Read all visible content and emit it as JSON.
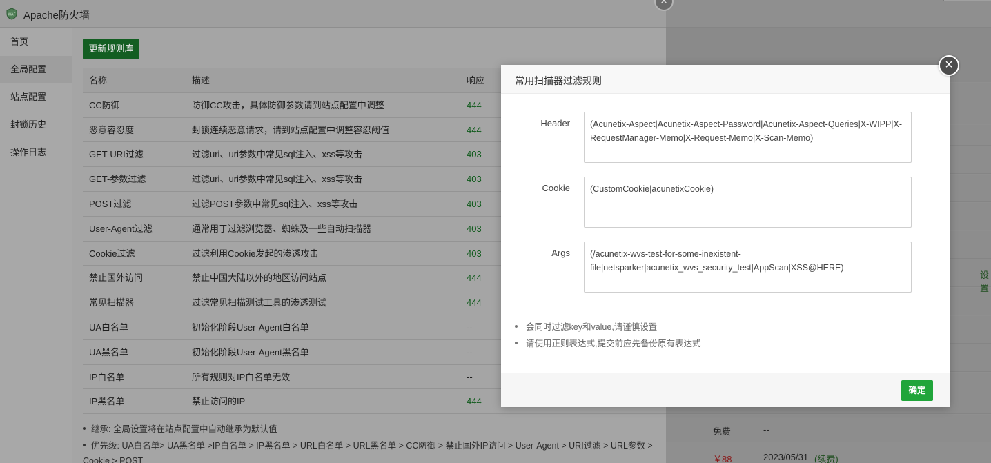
{
  "window": {
    "title": "Apache防火墙"
  },
  "sidebar": {
    "items": [
      {
        "label": "首页"
      },
      {
        "label": "全局配置"
      },
      {
        "label": "站点配置"
      },
      {
        "label": "封锁历史"
      },
      {
        "label": "操作日志"
      }
    ]
  },
  "content": {
    "update_button": "更新规则库",
    "table": {
      "headers": {
        "name": "名称",
        "desc": "描述",
        "resp": "响应"
      },
      "rows": [
        {
          "name": "CC防御",
          "desc": "防御CC攻击，具体防御参数请到站点配置中调整",
          "resp": "444"
        },
        {
          "name": "恶意容忍度",
          "desc": "封锁连续恶意请求，请到站点配置中调整容忍阈值",
          "resp": "444"
        },
        {
          "name": "GET-URI过滤",
          "desc": "过滤uri、uri参数中常见sql注入、xss等攻击",
          "resp": "403"
        },
        {
          "name": "GET-参数过滤",
          "desc": "过滤uri、uri参数中常见sql注入、xss等攻击",
          "resp": "403"
        },
        {
          "name": "POST过滤",
          "desc": "过滤POST参数中常见sql注入、xss等攻击",
          "resp": "403"
        },
        {
          "name": "User-Agent过滤",
          "desc": "通常用于过滤浏览器、蜘蛛及一些自动扫描器",
          "resp": "403"
        },
        {
          "name": "Cookie过滤",
          "desc": "过滤利用Cookie发起的渗透攻击",
          "resp": "403"
        },
        {
          "name": "禁止国外访问",
          "desc": "禁止中国大陆以外的地区访问站点",
          "resp": "444"
        },
        {
          "name": "常见扫描器",
          "desc": "过滤常见扫描测试工具的渗透测试",
          "resp": "444"
        },
        {
          "name": "UA白名单",
          "desc": "初始化阶段User-Agent白名单",
          "resp": "--"
        },
        {
          "name": "UA黑名单",
          "desc": "初始化阶段User-Agent黑名单",
          "resp": "--"
        },
        {
          "name": "IP白名单",
          "desc": "所有规则对IP白名单无效",
          "resp": "--"
        },
        {
          "name": "IP黑名单",
          "desc": "禁止访问的IP",
          "resp": "444"
        }
      ]
    },
    "notes": [
      "继承: 全局设置将在站点配置中自动继承为默认值",
      "优先级: UA白名单> UA黑名单 >IP白名单 > IP黑名单 > URL白名单 > URL黑名单 > CC防御 > 禁止国外IP访问 > User-Agent > URI过滤 > URL参数 >",
      "Cookie > POST"
    ]
  },
  "background_page": {
    "row_label_1": "设置",
    "row_type": "免费",
    "row_value": "--",
    "price": "￥88",
    "expiry_date": "2023/05/31",
    "renew": "(续费)"
  },
  "modal": {
    "title": "常用扫描器过滤规则",
    "fields": {
      "header": {
        "label": "Header",
        "value": "(Acunetix-Aspect|Acunetix-Aspect-Password|Acunetix-Aspect-Queries|X-WIPP|X-RequestManager-Memo|X-Request-Memo|X-Scan-Memo)"
      },
      "cookie": {
        "label": "Cookie",
        "value": "(CustomCookie|acunetixCookie)"
      },
      "args": {
        "label": "Args",
        "value": "(/acunetix-wvs-test-for-some-inexistent-file|netsparker|acunetix_wvs_security_test|AppScan|XSS@HERE)"
      }
    },
    "notes": [
      "会同时过滤key和value,请谨慎设置",
      "请使用正则表达式,提交前应先备份原有表达式"
    ],
    "confirm_button": "确定"
  },
  "colors": {
    "primary_green": "#20a53a",
    "response_green": "#0f5a1b"
  }
}
